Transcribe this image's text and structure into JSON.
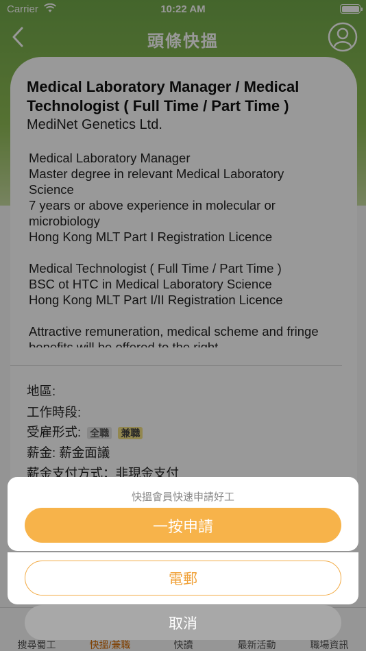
{
  "status_bar": {
    "carrier": "Carrier",
    "time": "10:22 AM"
  },
  "nav": {
    "title": "頭條快搵"
  },
  "job": {
    "title": "Medical Laboratory Manager / Medical Technologist ( Full Time / Part Time )",
    "company": "MediNet Genetics Ltd.",
    "description": "Medical Laboratory Manager\nMaster degree in relevant Medical Laboratory Science\n7 years or above experience in molecular or microbiology\nHong Kong MLT Part I Registration Licence\n\nMedical Technologist ( Full Time / Part Time )\nBSC ot HTC in Medical Laboratory Science\nHong Kong MLT  Part I/II Registration Licence\n\nAttractive remuneration, medical scheme and fringe benefits will be offered to the right"
  },
  "info": {
    "district": "地區:",
    "working_hours": "工作時段:",
    "employment_type": "受雇形式:",
    "employment_tags": [
      "全職",
      "兼職"
    ],
    "salary": "薪金: 薪金面議",
    "salary_payment": "薪金支付方式：非現金支付"
  },
  "tabs": [
    "搜尋蜀工",
    "快搵/兼職",
    "快讀",
    "最新活動",
    "職場資訊"
  ],
  "action_sheet": {
    "message": "快搵會員快速申請好工",
    "apply_label": "一按申請",
    "email_label": "電郵",
    "cancel_label": "取消"
  },
  "colors": {
    "accent": "#f7b34a",
    "header_green": "#72a94a"
  }
}
